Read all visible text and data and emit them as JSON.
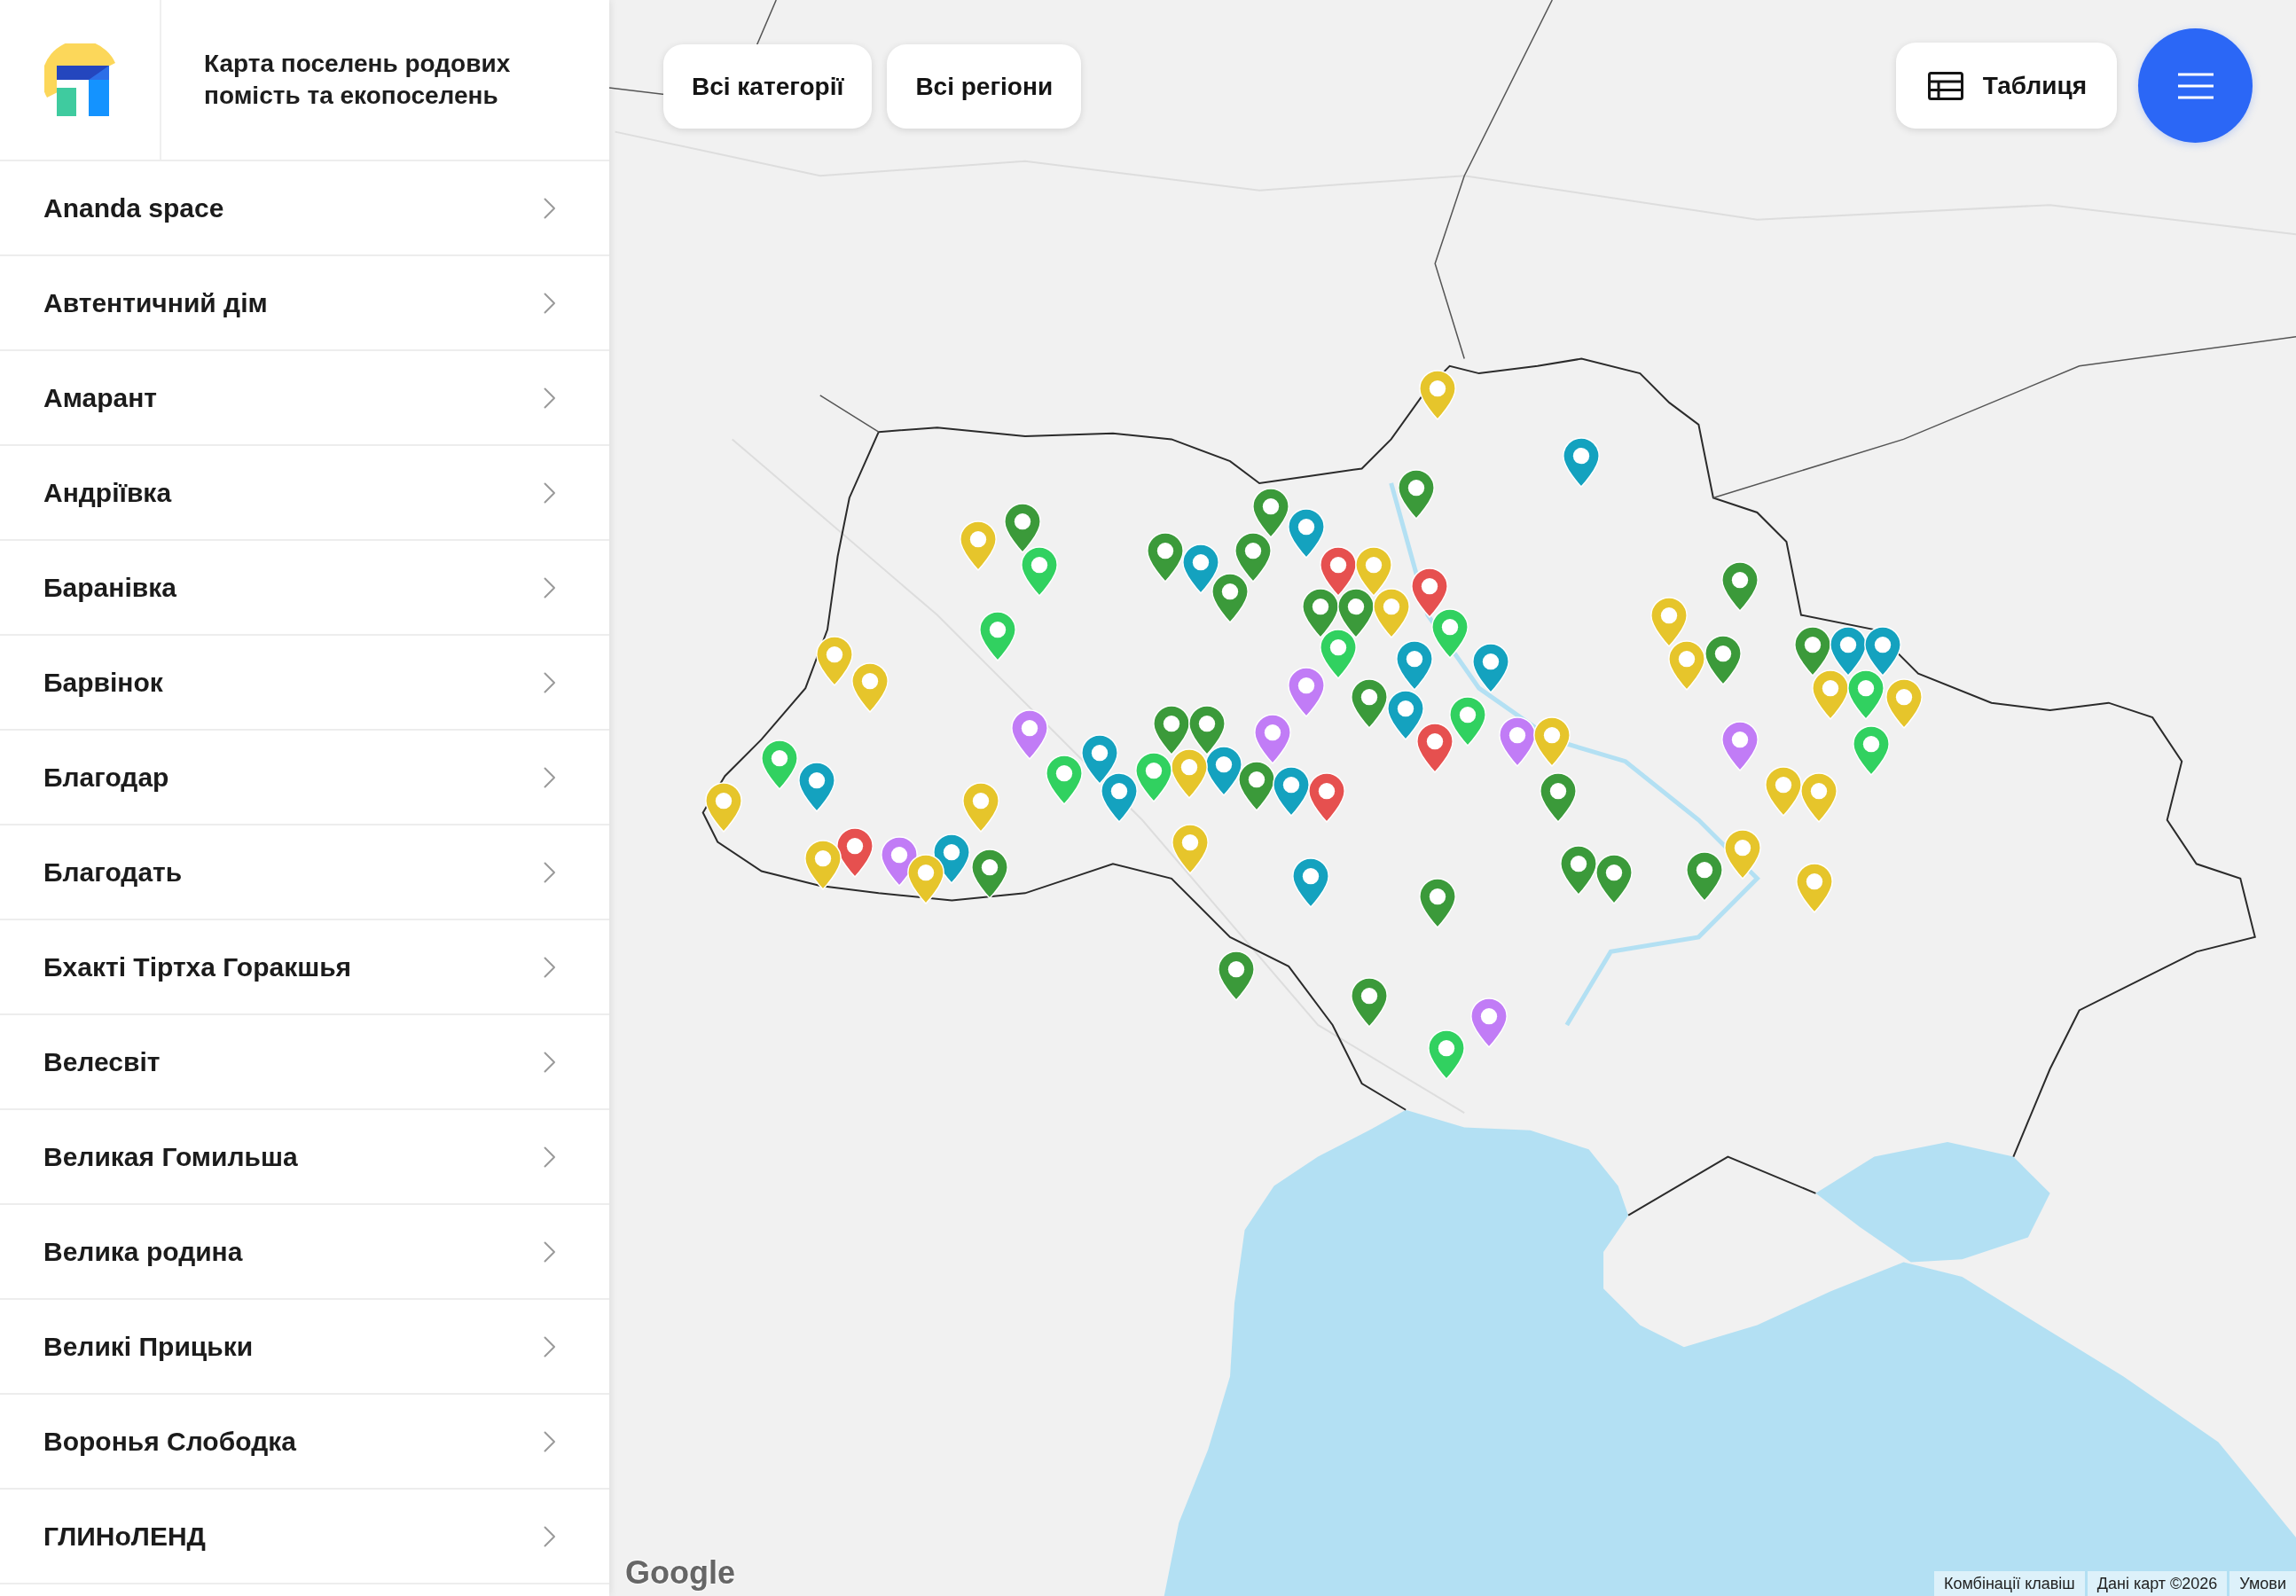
{
  "header": {
    "title": "Карта поселень родових помість та екопоселень"
  },
  "sidebar": {
    "items": [
      {
        "label": "Ananda space"
      },
      {
        "label": "Автентичний дім"
      },
      {
        "label": "Амарант"
      },
      {
        "label": "Андріївка"
      },
      {
        "label": "Баранівка"
      },
      {
        "label": "Барвінок"
      },
      {
        "label": "Благодар"
      },
      {
        "label": "Благодать"
      },
      {
        "label": "Бхакті Тіртха Горакшья"
      },
      {
        "label": "Велесвіт"
      },
      {
        "label": "Великая Гомильша"
      },
      {
        "label": "Велика родина"
      },
      {
        "label": "Великі Прицьки"
      },
      {
        "label": "Воронья Слободка"
      },
      {
        "label": "ГЛИНоЛЕНД"
      }
    ]
  },
  "toolbar": {
    "filters": [
      {
        "label": "Всі категорії"
      },
      {
        "label": "Всі регіони"
      }
    ],
    "table_button": {
      "label": "Таблиця"
    }
  },
  "map": {
    "pins": [
      {
        "color": "#e6c52b"
      },
      {
        "color": "#14a2bf"
      },
      {
        "color": "#3b9a3a"
      },
      {
        "color": "#3b9a3a"
      },
      {
        "color": "#3b9a3a"
      },
      {
        "color": "#14a2bf"
      },
      {
        "color": "#e6c52b"
      },
      {
        "color": "#3b9a3a"
      },
      {
        "color": "#3b9a3a"
      },
      {
        "color": "#14a2bf"
      },
      {
        "color": "#31d160"
      },
      {
        "color": "#e6504f"
      },
      {
        "color": "#e6c52b"
      },
      {
        "color": "#3b9a3a"
      },
      {
        "color": "#e6504f"
      },
      {
        "color": "#3b9a3a"
      },
      {
        "color": "#3b9a3a"
      },
      {
        "color": "#3b9a3a"
      },
      {
        "color": "#e6c52b"
      },
      {
        "color": "#e6c52b"
      },
      {
        "color": "#31d160"
      },
      {
        "color": "#31d160"
      },
      {
        "color": "#3b9a3a"
      },
      {
        "color": "#14a2bf"
      },
      {
        "color": "#14a2bf"
      },
      {
        "color": "#31d160"
      },
      {
        "color": "#3b9a3a"
      },
      {
        "color": "#e6c52b"
      },
      {
        "color": "#14a2bf"
      },
      {
        "color": "#e6c52b"
      },
      {
        "color": "#14a2bf"
      },
      {
        "color": "#e6c52b"
      },
      {
        "color": "#c17cf6"
      },
      {
        "color": "#e6c52b"
      },
      {
        "color": "#31d160"
      },
      {
        "color": "#e6c52b"
      },
      {
        "color": "#3b9a3a"
      },
      {
        "color": "#14a2bf"
      },
      {
        "color": "#31d160"
      },
      {
        "color": "#3b9a3a"
      },
      {
        "color": "#3b9a3a"
      },
      {
        "color": "#c17cf6"
      },
      {
        "color": "#e6504f"
      },
      {
        "color": "#c17cf6"
      },
      {
        "color": "#c17cf6"
      },
      {
        "color": "#e6c52b"
      },
      {
        "color": "#31d160"
      },
      {
        "color": "#c17cf6"
      },
      {
        "color": "#14a2bf"
      },
      {
        "color": "#31d160"
      },
      {
        "color": "#14a2bf"
      },
      {
        "color": "#e6c52b"
      },
      {
        "color": "#31d160"
      },
      {
        "color": "#31d160"
      },
      {
        "color": "#3b9a3a"
      },
      {
        "color": "#3b9a3a"
      },
      {
        "color": "#14a2bf"
      },
      {
        "color": "#14a2bf"
      },
      {
        "color": "#e6c52b"
      },
      {
        "color": "#e6504f"
      },
      {
        "color": "#e6c52b"
      },
      {
        "color": "#14a2bf"
      },
      {
        "color": "#e6c52b"
      },
      {
        "color": "#e6c52b"
      },
      {
        "color": "#e6c52b"
      },
      {
        "color": "#e6504f"
      },
      {
        "color": "#e6c52b"
      },
      {
        "color": "#14a2bf"
      },
      {
        "color": "#c17cf6"
      },
      {
        "color": "#e6c52b"
      },
      {
        "color": "#3b9a3a"
      },
      {
        "color": "#3b9a3a"
      },
      {
        "color": "#3b9a3a"
      },
      {
        "color": "#3b9a3a"
      },
      {
        "color": "#e6c52b"
      },
      {
        "color": "#14a2bf"
      },
      {
        "color": "#e6c52b"
      },
      {
        "color": "#3b9a3a"
      },
      {
        "color": "#3b9a3a"
      },
      {
        "color": "#3b9a3a"
      },
      {
        "color": "#c17cf6"
      },
      {
        "color": "#31d160"
      }
    ],
    "logo": "Google",
    "attribution": [
      "Комбінації клавіш",
      "Дані карт ©2026",
      "Умови"
    ]
  }
}
